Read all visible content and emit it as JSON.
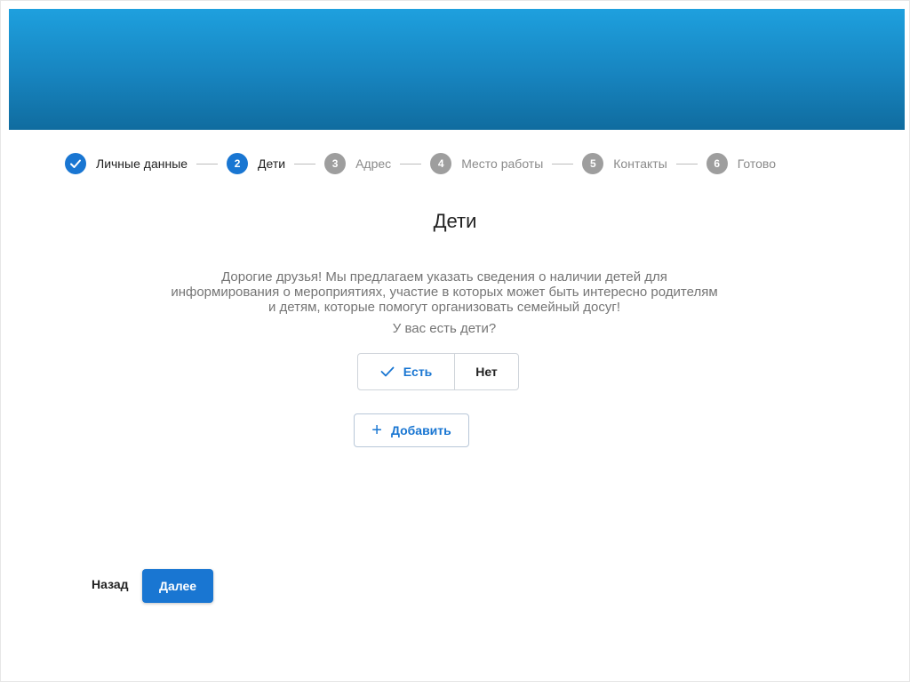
{
  "colors": {
    "accent": "#1976d2",
    "banner_top": "#1ea0de",
    "banner_bottom": "#106c9f",
    "inactive_step": "#9e9e9e"
  },
  "stepper": {
    "steps": [
      {
        "number": "",
        "label": "Личные данные",
        "state": "completed"
      },
      {
        "number": "2",
        "label": "Дети",
        "state": "active"
      },
      {
        "number": "3",
        "label": "Адрес",
        "state": "inactive"
      },
      {
        "number": "4",
        "label": "Место работы",
        "state": "inactive"
      },
      {
        "number": "5",
        "label": "Контакты",
        "state": "inactive"
      },
      {
        "number": "6",
        "label": "Готово",
        "state": "inactive"
      }
    ]
  },
  "main": {
    "title": "Дети",
    "description_lines": [
      "Дорогие друзья! Мы предлагаем указать сведения о наличии детей для",
      "информирования о мероприятиях, участие в которых может быть интересно родителям",
      "и детям, которые помогут организовать семейный досуг!"
    ],
    "question": "У вас есть дети?",
    "toggle": {
      "yes_label": "Есть",
      "no_label": "Нет",
      "selected": "yes"
    },
    "add_label": "Добавить"
  },
  "footer": {
    "back_label": "Назад",
    "next_label": "Далее"
  }
}
